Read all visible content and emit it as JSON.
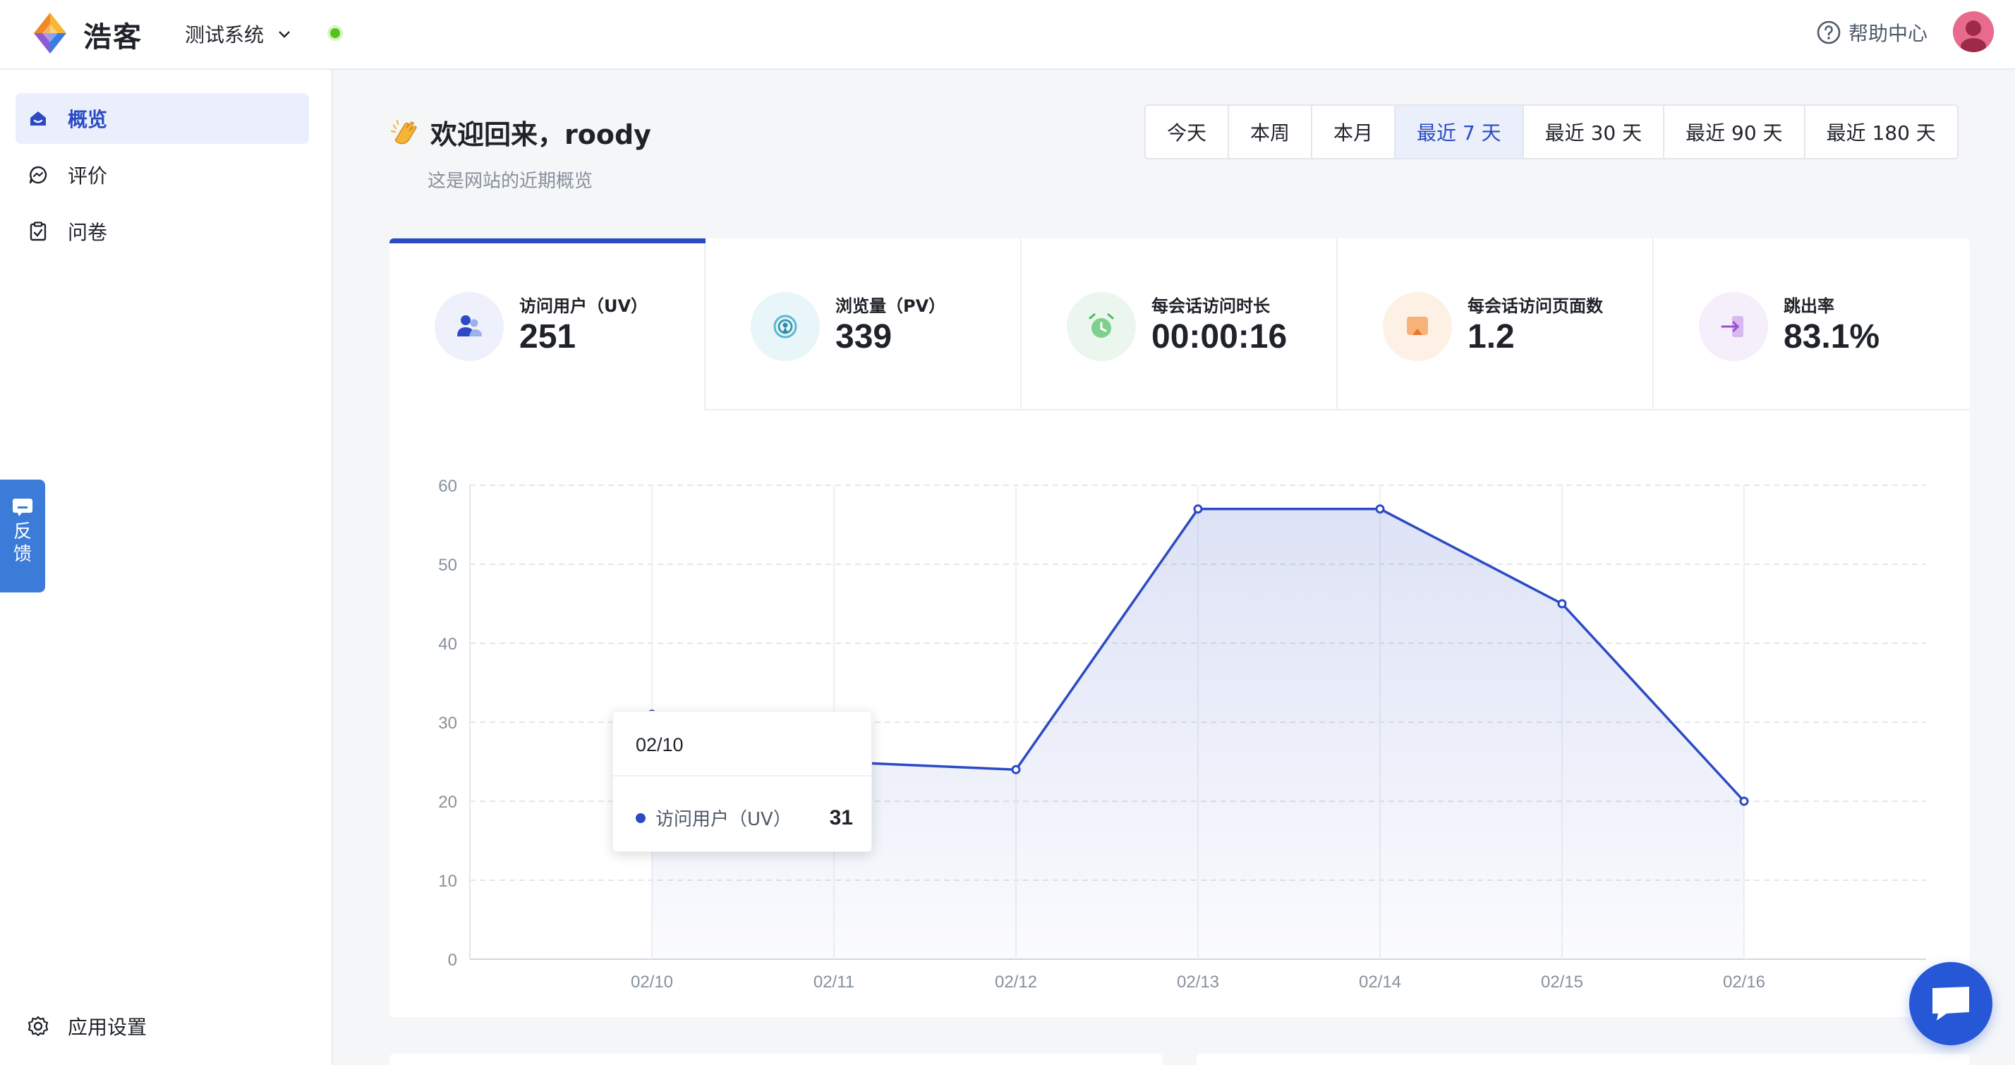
{
  "header": {
    "brand": "浩客",
    "system_select": "测试系统",
    "help_label": "帮助中心"
  },
  "sidebar": {
    "items": [
      {
        "label": "概览",
        "icon": "home-icon"
      },
      {
        "label": "评价",
        "icon": "chat-bubble-icon"
      },
      {
        "label": "问卷",
        "icon": "clipboard-icon"
      }
    ],
    "settings_label": "应用设置",
    "feedback_label": "反馈"
  },
  "main": {
    "welcome": "欢迎回来，roody",
    "subtitle": "这是网站的近期概览",
    "ranges": [
      "今天",
      "本周",
      "本月",
      "最近 7 天",
      "最近 30 天",
      "最近 90 天",
      "最近 180 天"
    ],
    "active_range": "最近 7 天",
    "stats": [
      {
        "label": "访问用户（UV）",
        "value": "251"
      },
      {
        "label": "浏览量（PV）",
        "value": "339"
      },
      {
        "label": "每会话访问时长",
        "value": "00:00:16"
      },
      {
        "label": "每会话访问页面数",
        "value": "1.2"
      },
      {
        "label": "跳出率",
        "value": "83.1%"
      }
    ],
    "tooltip": {
      "date": "02/10",
      "series": "访问用户（UV）",
      "value": "31"
    }
  },
  "colors": {
    "accent": "#2b4ac4",
    "status_green": "#52c41a",
    "feedback_blue": "#3d7bd9",
    "chat_blue": "#2557d6"
  },
  "chart_data": {
    "type": "area",
    "x": [
      "02/10",
      "02/11",
      "02/12",
      "02/13",
      "02/14",
      "02/15",
      "02/16"
    ],
    "series": [
      {
        "name": "访问用户（UV）",
        "values": [
          31,
          25,
          24,
          57,
          57,
          45,
          20
        ]
      }
    ],
    "yticks": [
      0,
      10,
      20,
      30,
      40,
      50,
      60
    ],
    "ylim": [
      0,
      60
    ],
    "grid": true
  }
}
